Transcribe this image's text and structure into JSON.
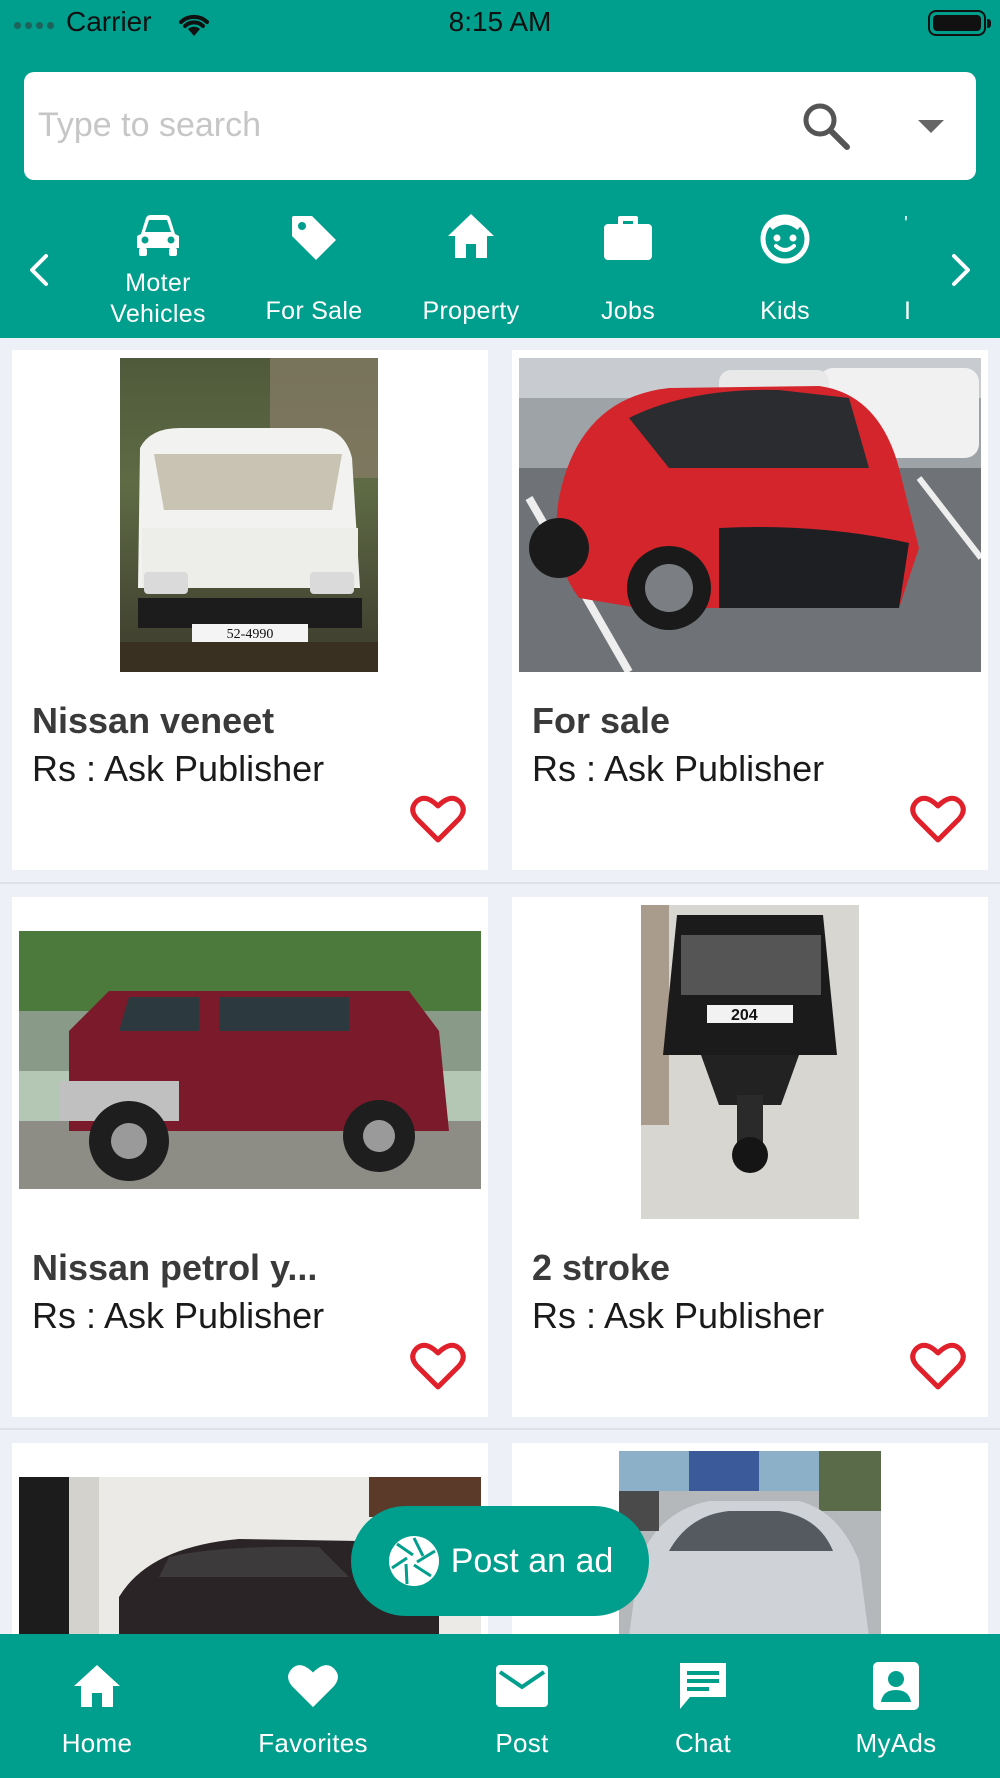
{
  "status_bar": {
    "carrier": "Carrier",
    "time": "8:15 AM"
  },
  "search": {
    "placeholder": "Type to search"
  },
  "categories": [
    {
      "label": "Moter Vehicles",
      "icon": "car-icon"
    },
    {
      "label": "For Sale",
      "icon": "tag-icon"
    },
    {
      "label": "Property",
      "icon": "home-icon"
    },
    {
      "label": "Jobs",
      "icon": "briefcase-icon"
    },
    {
      "label": "Kids",
      "icon": "child-face-icon"
    }
  ],
  "listings": [
    {
      "title": "Nissan veneet",
      "price": "Rs : Ask Publisher",
      "plate": "52-4990"
    },
    {
      "title": "For sale",
      "price": "Rs : Ask Publisher"
    },
    {
      "title": "Nissan petrol y...",
      "price": "Rs : Ask Publisher"
    },
    {
      "title": "2 stroke",
      "price": "Rs : Ask Publisher",
      "plate": "204"
    }
  ],
  "post_button": {
    "label": "Post an ad"
  },
  "tabs": [
    {
      "label": "Home",
      "icon": "home-icon"
    },
    {
      "label": "Favorites",
      "icon": "heart-icon"
    },
    {
      "label": "Post",
      "icon": "mail-icon"
    },
    {
      "label": "Chat",
      "icon": "chat-icon"
    },
    {
      "label": "MyAds",
      "icon": "account-box-icon"
    }
  ],
  "colors": {
    "primary": "#009e8c",
    "favorite": "#e0202a",
    "background": "#eef0f7"
  }
}
